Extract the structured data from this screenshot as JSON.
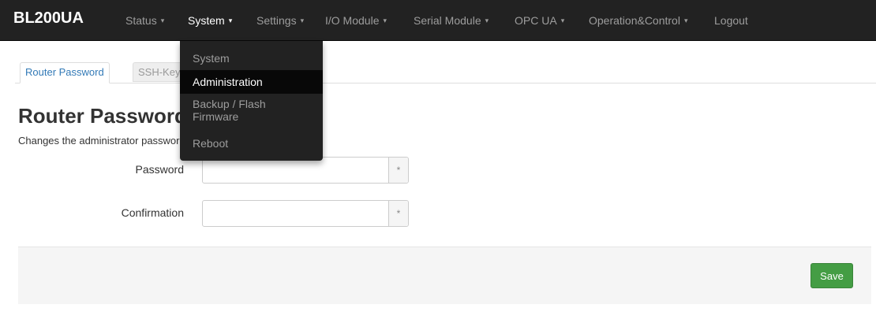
{
  "brand": "BL200UA",
  "nav": [
    {
      "label": "Status",
      "caret": "▾"
    },
    {
      "label": "System",
      "caret": "▾"
    },
    {
      "label": "Settings",
      "caret": "▾"
    },
    {
      "label": "I/O Module",
      "caret": "▾"
    },
    {
      "label": "Serial Module",
      "caret": "▾"
    },
    {
      "label": "OPC UA",
      "caret": "▾"
    },
    {
      "label": "Operation&Control",
      "caret": "▾"
    },
    {
      "label": "Logout"
    }
  ],
  "system_menu": {
    "items": [
      "System",
      "Administration",
      "Backup / Flash",
      "Firmware",
      "Reboot"
    ],
    "active": "Administration"
  },
  "tabs": {
    "active": "Router Password",
    "other": "SSH-Keys"
  },
  "page": {
    "title": "Router Password",
    "description": "Changes the administrator password for accessing the device"
  },
  "form": {
    "password_label": "Password",
    "confirmation_label": "Confirmation",
    "password_value": "",
    "confirmation_value": "",
    "reveal_symbol": "*"
  },
  "actions": {
    "save_label": "Save"
  },
  "colors": {
    "navbar": "#222222",
    "save_button": "#449d44",
    "link": "#337ab7"
  }
}
